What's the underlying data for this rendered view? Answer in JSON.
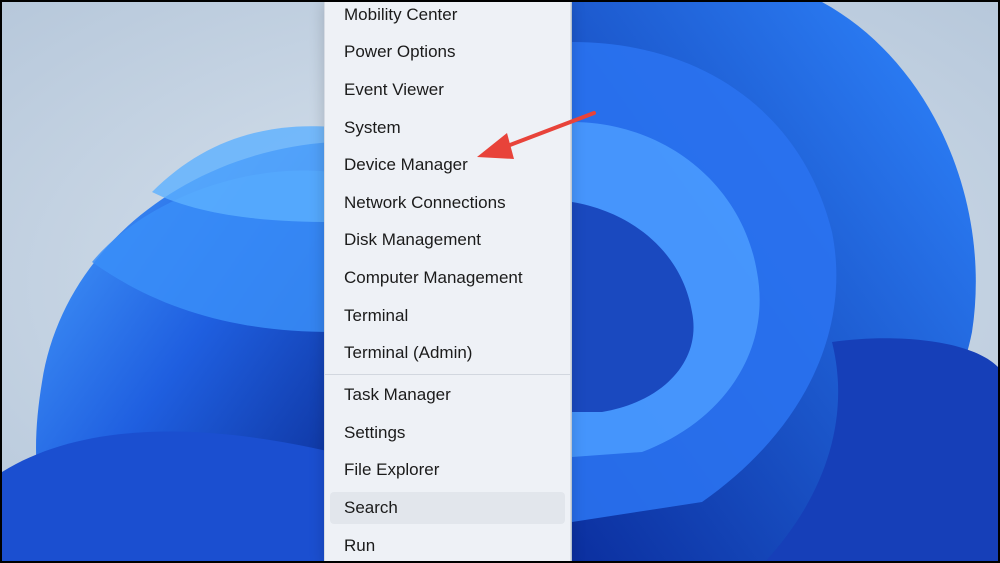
{
  "menu": {
    "items": [
      {
        "label": "Mobility Center"
      },
      {
        "label": "Power Options"
      },
      {
        "label": "Event Viewer"
      },
      {
        "label": "System"
      },
      {
        "label": "Device Manager"
      },
      {
        "label": "Network Connections"
      },
      {
        "label": "Disk Management"
      },
      {
        "label": "Computer Management"
      },
      {
        "label": "Terminal"
      },
      {
        "label": "Terminal (Admin)"
      },
      {
        "label": "Task Manager"
      },
      {
        "label": "Settings"
      },
      {
        "label": "File Explorer"
      },
      {
        "label": "Search"
      },
      {
        "label": "Run"
      }
    ],
    "hovered_item": "Search"
  },
  "annotation": {
    "type": "arrow",
    "color": "#e8433a",
    "points_to": "Device Manager"
  },
  "colors": {
    "menu_bg": "#eef1f6",
    "wallpaper_blue": "#1d4fd1",
    "wallpaper_bg": "#c9d7e6"
  }
}
